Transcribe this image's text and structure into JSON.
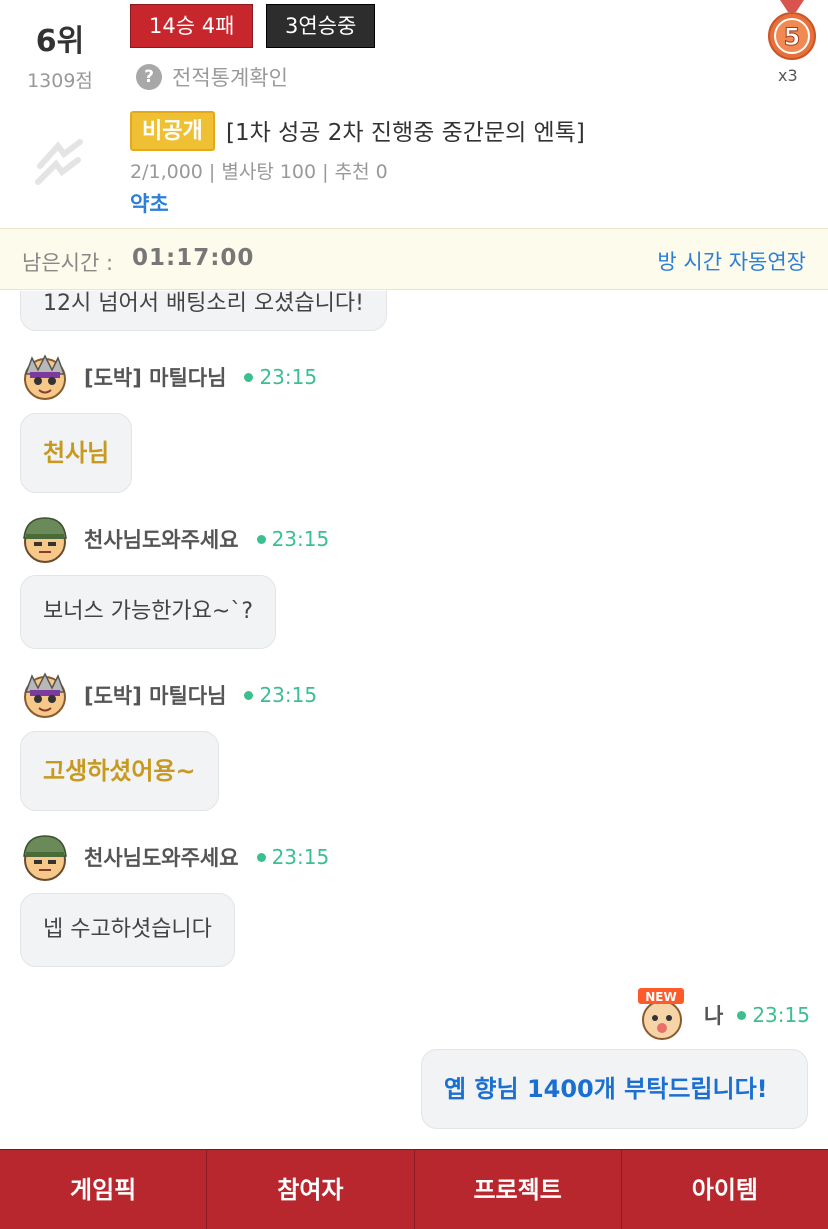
{
  "header": {
    "rank": "6위",
    "score": "1309점",
    "record_badge": "14승 4패",
    "streak_badge": "3연승중",
    "stats_link": "전적통계확인",
    "stats_icon": "?",
    "medal_number": "5",
    "medal_count": "x3"
  },
  "room": {
    "private_tag": "비공개",
    "title": "[1차 성공 2차 진행중 중간문의 엔톡]",
    "meta": "2/1,000 | 별사탕 100 | 추천 0",
    "owner": "약초"
  },
  "timer": {
    "label": "남은시간 :",
    "value": "01:17:00",
    "extend_label": "방 시간 자동연장"
  },
  "chat": {
    "cut_message": "12시 넘어서 배팅소리 오셨습니다!",
    "messages": [
      {
        "sender": "[도박] 마틸다님",
        "time": "23:15",
        "text": "천사님"
      },
      {
        "sender": "천사님도와주세요",
        "time": "23:15",
        "text": "보너스 가능한가요~`?"
      },
      {
        "sender": "[도박] 마틸다님",
        "time": "23:15",
        "text": "고생하셨어용~"
      },
      {
        "sender": "천사님도와주세요",
        "time": "23:15",
        "text": "넵 수고하셧습니다"
      }
    ],
    "mine": {
      "sender": "나",
      "time": "23:15",
      "text": "옙 향님 1400개 부탁드립니다!",
      "new_badge": "NEW"
    }
  },
  "nav": {
    "items": [
      "게임픽",
      "참여자",
      "프로젝트",
      "아이템"
    ]
  },
  "colors": {
    "accent_red": "#b8272d",
    "gold_text": "#c79a1f",
    "link_blue": "#2b7fd8",
    "online_green": "#3bbf8f"
  }
}
